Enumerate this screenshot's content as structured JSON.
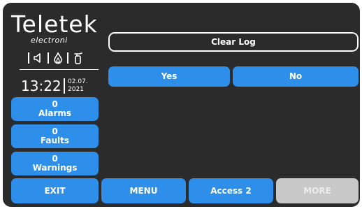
{
  "brand": {
    "logo": "Teletek",
    "sub": "electroni"
  },
  "status_icons": [
    "speaker-icon",
    "fire-icon",
    "fire-extinguisher-icon"
  ],
  "clock": {
    "time": "13:22",
    "date_day": "02.07.",
    "date_year": "2021"
  },
  "counters": {
    "alarms": {
      "count": "0",
      "label": "Alarms"
    },
    "faults": {
      "count": "0",
      "label": "Faults"
    },
    "warnings": {
      "count": "0",
      "label": "Warnings"
    }
  },
  "dialog": {
    "title": "Clear Log",
    "yes_label": "Yes",
    "no_label": "No"
  },
  "bottom_bar": {
    "exit": "EXIT",
    "menu": "MENU",
    "access": "Access 2",
    "more": "MORE"
  },
  "colors": {
    "button": "#2d8fea",
    "background": "#2b2b2b",
    "disabled": "#c8c8c8"
  }
}
